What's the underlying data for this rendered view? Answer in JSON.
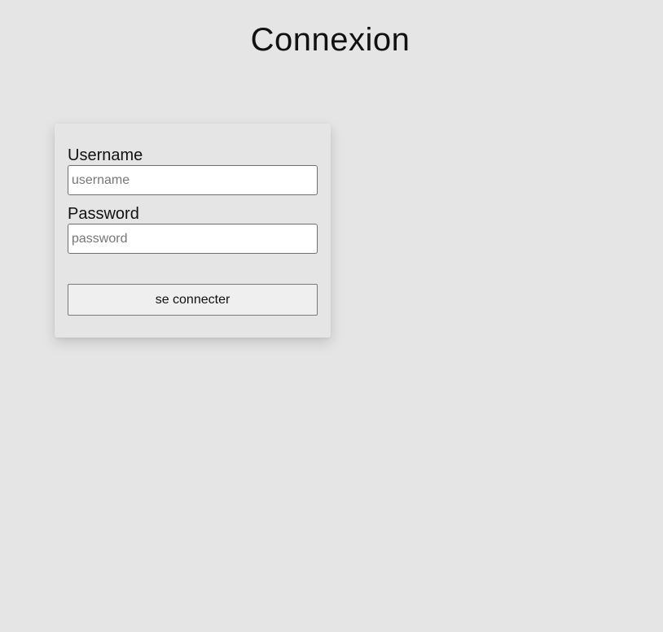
{
  "page": {
    "title": "Connexion"
  },
  "login_form": {
    "username_label": "Username",
    "username_placeholder": "username",
    "username_value": "",
    "password_label": "Password",
    "password_placeholder": "password",
    "password_value": "",
    "submit_label": "se connecter"
  },
  "colors": {
    "background": "#e5e5e5",
    "input_background": "#ffffff",
    "button_background": "#efefef",
    "text": "#111111"
  }
}
